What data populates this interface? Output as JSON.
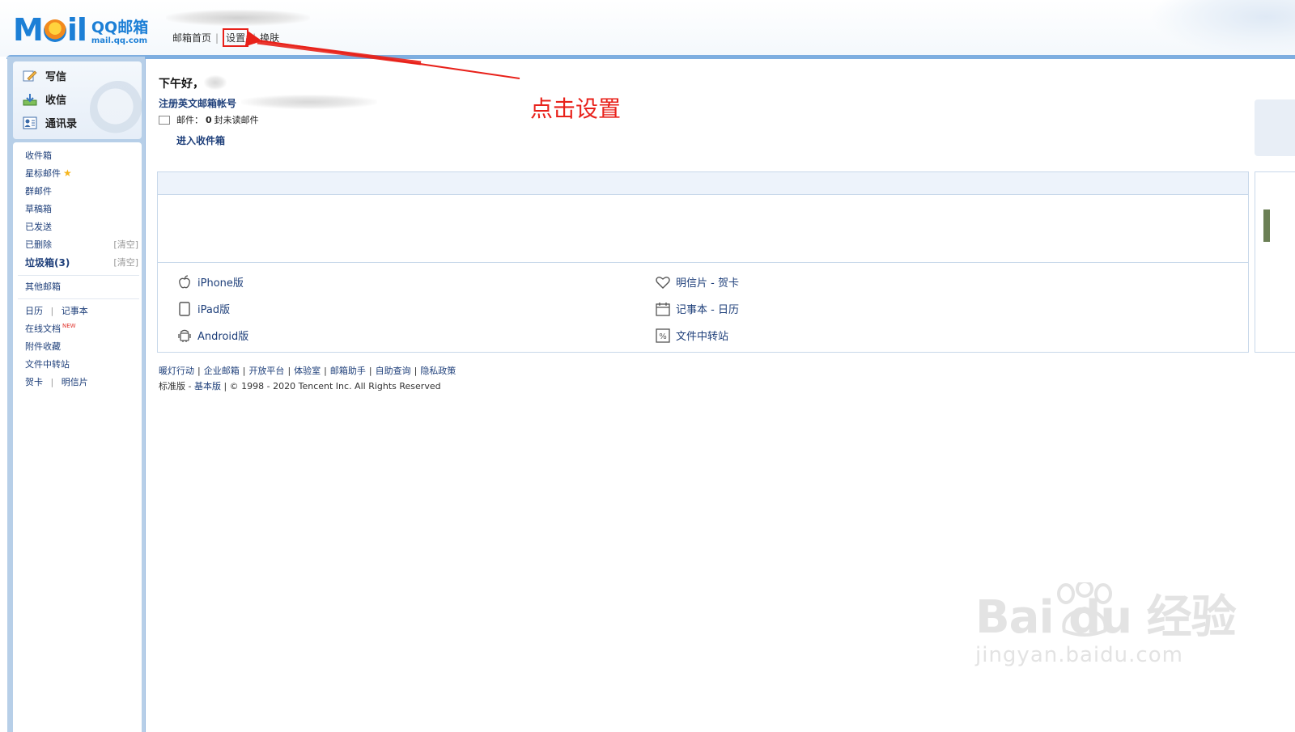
{
  "header": {
    "logo_text": "M",
    "logo_text2": "il",
    "logo_brand": "QQ邮箱",
    "logo_domain": "mail.qq.com",
    "nav": [
      "邮箱首页",
      "设置",
      "换肤"
    ]
  },
  "sidebar": {
    "quick": [
      {
        "label": "写信",
        "icon": "compose-icon"
      },
      {
        "label": "收信",
        "icon": "inbox-download-icon"
      },
      {
        "label": "通讯录",
        "icon": "contacts-icon"
      }
    ],
    "folders": [
      {
        "label": "收件箱"
      },
      {
        "label": "星标邮件"
      },
      {
        "label": "群邮件"
      },
      {
        "label": "草稿箱"
      },
      {
        "label": "已发送"
      },
      {
        "label": "已删除",
        "action": "[清空]"
      },
      {
        "label": "垃圾箱(3)",
        "action": "[清空]"
      }
    ],
    "other_mail": "其他邮箱",
    "tools": {
      "calendar": "日历",
      "notebook": "记事本",
      "online_docs": "在线文档",
      "new_badge": "NEW",
      "attachments": "附件收藏",
      "file_transfer": "文件中转站",
      "card": "贺卡",
      "postcard": "明信片",
      "sep": "|"
    }
  },
  "main": {
    "greeting": "下午好，",
    "register_link": "注册英文邮箱帐号",
    "mail_label": "邮件：",
    "unread_count": "0",
    "unread_suffix": "封未读邮件",
    "inbox_link": "进入收件箱",
    "annotation": "点击设置",
    "apps_left": [
      {
        "label": "iPhone版",
        "icon": "apple-icon"
      },
      {
        "label": "iPad版",
        "icon": "tablet-icon"
      },
      {
        "label": "Android版",
        "icon": "android-icon"
      }
    ],
    "apps_right": [
      {
        "label": "明信片 - 贺卡",
        "icon": "heart-icon"
      },
      {
        "label": "记事本 - 日历",
        "icon": "calendar-icon"
      },
      {
        "label": "文件中转站",
        "icon": "file-transfer-icon"
      }
    ],
    "footer_links": [
      "暖灯行动",
      "企业邮箱",
      "开放平台",
      "体验室",
      "邮箱助手",
      "自助查询",
      "隐私政策"
    ],
    "footer_sep": "|",
    "footer_version_std": "标准版",
    "footer_version_dash": " - ",
    "footer_version_basic": "基本版",
    "copyright": "| © 1998 - 2020 Tencent Inc. All Rights Reserved"
  },
  "watermark": {
    "brand": "Bai du 经验",
    "url": "jingyan.baidu.com"
  },
  "colors": {
    "accent": "#1c7fd6",
    "link": "#1e3f7a",
    "annotation": "#e8211a",
    "frame": "#b7cfe8"
  }
}
